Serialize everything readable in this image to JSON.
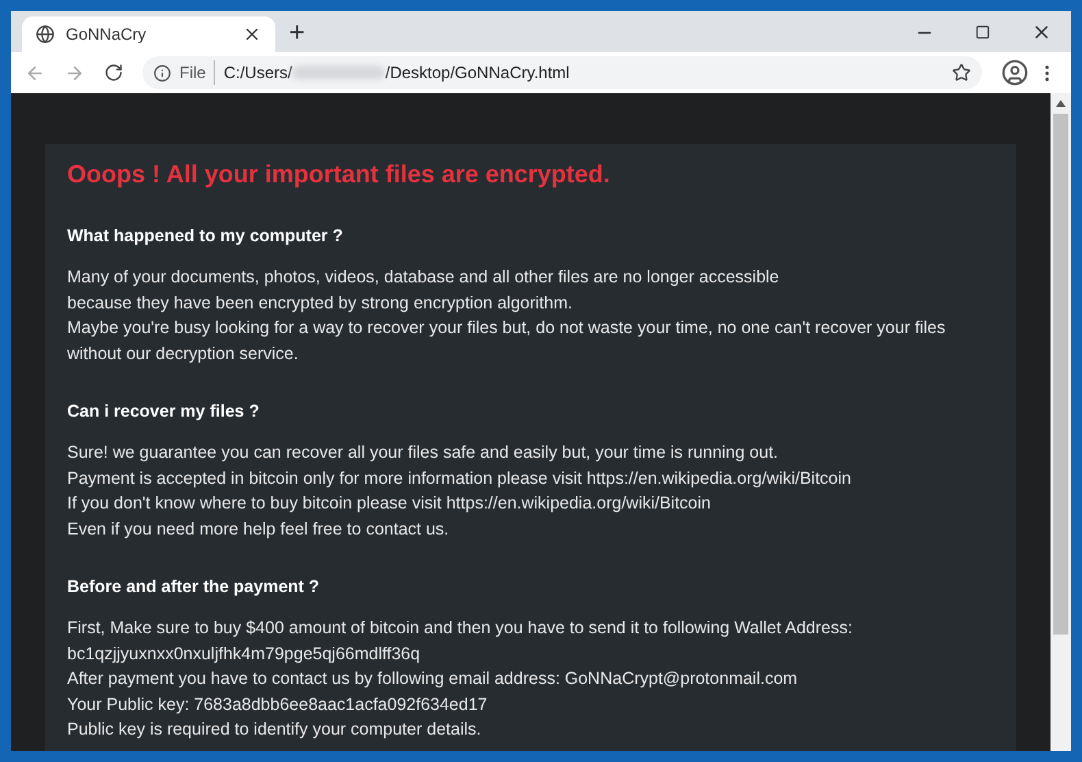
{
  "tab": {
    "title": "GoNNaCry",
    "new_tab": "+"
  },
  "address_bar": {
    "scheme": "File",
    "url_start": "C:/Users/",
    "url_end": "/Desktop/GoNNaCry.html"
  },
  "page": {
    "title": "Ooops ! All your important files are encrypted.",
    "sections": [
      {
        "heading": "What happened to my computer ?",
        "lines": [
          "Many of your documents, photos, videos, database and all other files are no longer accessible",
          "because they have been encrypted by strong encryption algorithm.",
          "Maybe you're busy looking for a way to recover your files but, do not waste your time, no one can't recover your files without our decryption service."
        ]
      },
      {
        "heading": "Can i recover my files ?",
        "lines": [
          "Sure! we guarantee you can recover all your files safe and easily but, your time is running out.",
          "Payment is accepted in bitcoin only for more information please visit https://en.wikipedia.org/wiki/Bitcoin",
          "If you don't know where to buy bitcoin please visit https://en.wikipedia.org/wiki/Bitcoin",
          "Even if you need more help feel free to contact us."
        ]
      },
      {
        "heading": "Before and after the payment ?",
        "lines": [
          "First, Make sure to buy $400 amount of bitcoin and then you have to send it to following Wallet Address:",
          "bc1qzjjyuxnxx0nxuljfhk4m79pge5qj66mdlff36q",
          "After payment you have to contact us by following email address: GoNNaCrypt@protonmail.com",
          "Your Public key: 7683a8dbb6ee8aac1acfa092f634ed17",
          "Public key is required to identify your computer details."
        ]
      }
    ]
  }
}
